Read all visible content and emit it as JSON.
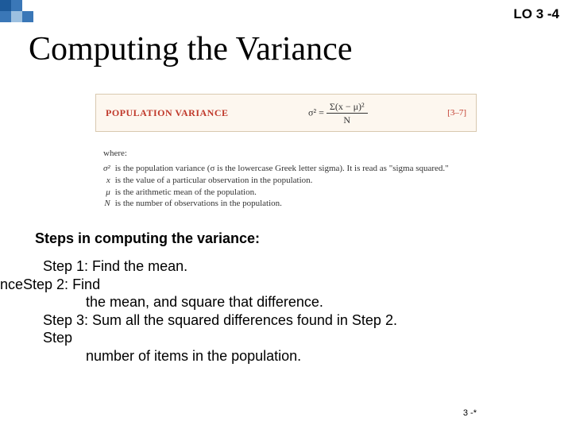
{
  "lo_tag": "LO 3 -4",
  "title": "Computing the Variance",
  "formula": {
    "label": "POPULATION VARIANCE",
    "lhs": "σ² =",
    "numerator": "Σ(x − μ)²",
    "denominator": "N",
    "eqref": "[3–7]"
  },
  "where": {
    "heading": "where:",
    "rows": [
      {
        "sym": "σ²",
        "desc": "is the population variance (σ is the lowercase Greek letter sigma). It is read as \"sigma squared.\""
      },
      {
        "sym": "x",
        "desc": "is the value of a particular observation in the population."
      },
      {
        "sym": "μ",
        "desc": "is the arithmetic mean of the population."
      },
      {
        "sym": "N",
        "desc": "is the number of observations in the population."
      }
    ]
  },
  "steps_header": "Steps in computing the variance:",
  "steps": {
    "s1": "Step 1:  Find the mean.",
    "s2a": "nceStep 2: Find",
    "s2b": "the mean, and square that difference.",
    "s3": "Step 3: Sum all the squared differences found in Step 2.",
    "s4a": "Step",
    "s4b": "number of items in the population."
  },
  "footer": "3 -*"
}
